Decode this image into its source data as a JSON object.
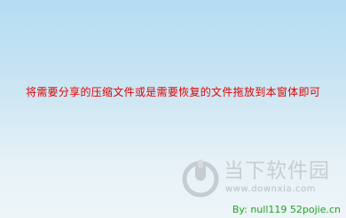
{
  "drop_zone": {
    "instruction": "将需要分享的压缩文件或是需要恢复的文件拖放到本窗体即可"
  },
  "watermark": {
    "title": "当下软件园",
    "url": "www.downxia.com",
    "icon": "downxia-logo-icon"
  },
  "footer": {
    "credit": "By: null119  52pojie.cn"
  },
  "colors": {
    "instruction_text": "#e00000",
    "credit_text": "#22a022",
    "background_top": "#b3dcf2",
    "background_bottom": "#edf5f8"
  }
}
